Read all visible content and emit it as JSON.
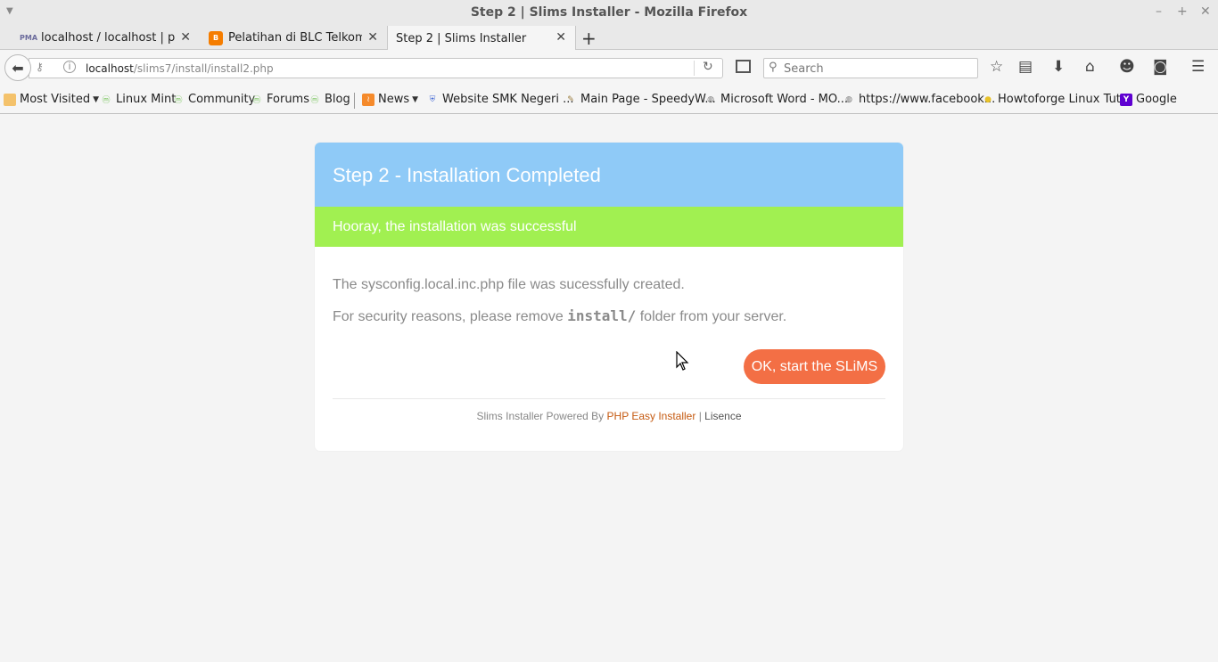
{
  "window": {
    "title": "Step 2 | Slims Installer - Mozilla Firefox",
    "controls": {
      "minimize": "–",
      "maximize": "+",
      "close": "✕"
    }
  },
  "tabs": [
    {
      "label": "localhost / localhost | ph...",
      "favicon": "PMA",
      "active": false
    },
    {
      "label": "Pelatihan di BLC Telkom ...",
      "favicon": "B",
      "active": false
    },
    {
      "label": "Step 2 | Slims Installer",
      "favicon": "",
      "active": true
    }
  ],
  "tab_close": "✕",
  "new_tab": "+",
  "navbar": {
    "url_host": "localhost",
    "url_path": "/slims7/install/install2.php",
    "search_placeholder": "Search"
  },
  "bookmarks": [
    {
      "label": "Most Visited",
      "dropdown": true,
      "icon": "folder-icon"
    },
    {
      "label": "Linux Mint",
      "icon": "mint-icon"
    },
    {
      "label": "Community",
      "icon": "mint-icon"
    },
    {
      "label": "Forums",
      "icon": "mint-icon"
    },
    {
      "label": "Blog",
      "icon": "mint-icon"
    },
    {
      "label": "News",
      "dropdown": true,
      "icon": "rss-icon"
    },
    {
      "label": "Website SMK Negeri ...",
      "icon": "shield-icon"
    },
    {
      "label": "Main Page - SpeedyW...",
      "icon": "page-icon"
    },
    {
      "label": "Microsoft Word - MO...",
      "icon": "globe-icon"
    },
    {
      "label": "https://www.facebook...",
      "icon": "globe-icon"
    },
    {
      "label": "Howtoforge Linux Tut...",
      "icon": "bulb-icon"
    },
    {
      "label": "Google",
      "icon": "yahoo-icon",
      "glyph": "Y"
    }
  ],
  "installer": {
    "heading": "Step 2 - Installation Completed",
    "success_message": "Hooray, the installation was successful",
    "line1": "The sysconfig.local.inc.php file was sucessfully created.",
    "line2_before": "For security reasons, please remove ",
    "line2_code": "install/",
    "line2_after": " folder from your server.",
    "ok_button": "OK, start the SLiMS",
    "footer_prefix": "Slims Installer Powered By ",
    "footer_link": "PHP Easy Installer",
    "footer_sep": " | ",
    "footer_licence": "Lisence"
  },
  "colors": {
    "header_blue": "#8fcaf7",
    "success_green": "#a1f051",
    "button_orange": "#f36f45",
    "link_orange": "#c55a11"
  }
}
